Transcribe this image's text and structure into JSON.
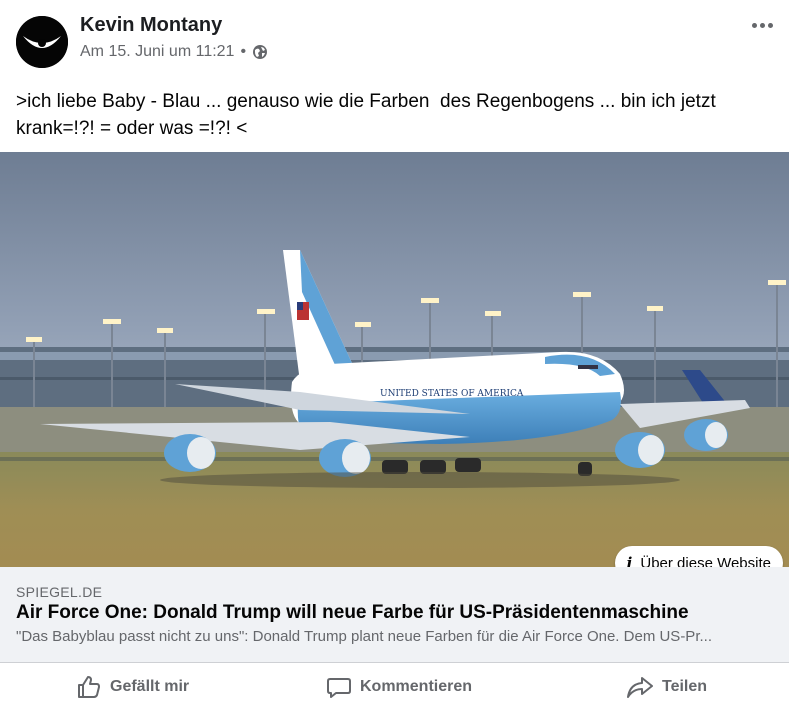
{
  "post": {
    "author": "Kevin Montany",
    "timestamp": "Am 15. Juni um 11:21",
    "separator": "•",
    "privacy_icon": "globe-icon",
    "more_icon": "more-options-icon",
    "text": ">ich liebe Baby - Blau ... genauso wie die Farben  des Regenbogens ... bin ich jetzt krank=!?! = oder was =!?! <"
  },
  "photo": {
    "fuselage_text": "UNITED STATES OF AMERICA"
  },
  "about_site": {
    "icon": "i",
    "label": "Über diese Website"
  },
  "link_preview": {
    "domain": "SPIEGEL.DE",
    "title": "Air Force One: Donald Trump will neue Farbe für US-Präsidentenmaschine",
    "description": "\"Das Babyblau passt nicht zu uns\": Donald Trump plant neue Farben für die Air Force One. Dem US-Pr..."
  },
  "actions": {
    "like": "Gefällt mir",
    "comment": "Kommentieren",
    "share": "Teilen"
  },
  "colors": {
    "text_primary": "#050505",
    "text_secondary": "#65676b",
    "link_bg": "#f0f2f5",
    "divider": "#ced0d4",
    "plane_blue": "#5fa2d6"
  }
}
